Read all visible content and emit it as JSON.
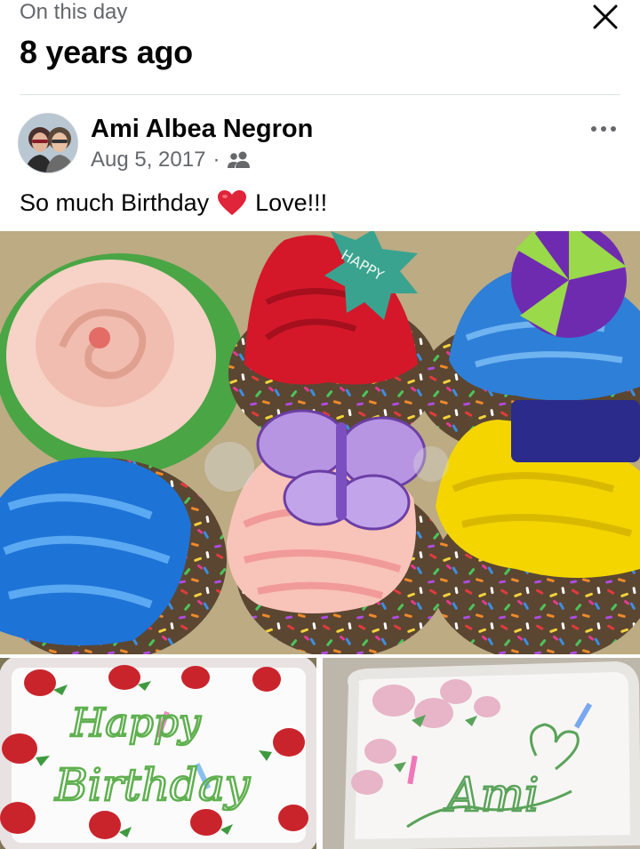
{
  "memory": {
    "eyebrow": "On this day",
    "title": "8 years ago",
    "close_icon": "close-icon"
  },
  "post": {
    "author": "Ami Albea Negron",
    "date": "Aug 5, 2017",
    "separator": "·",
    "audience_icon": "friends-icon",
    "more_icon": "more-horizontal-icon",
    "caption_before": "So much Birthday",
    "caption_emoji": "red-heart-emoji",
    "caption_after": "Love!!!"
  },
  "photos": {
    "main": {
      "topper_text": "HAPPY"
    },
    "left": {
      "cake_text_line1": "Happy",
      "cake_text_line2": "Birthday"
    },
    "right": {
      "cake_text": "Ami"
    }
  },
  "colors": {
    "secondary_text": "#65676b",
    "heart": "#e0243a",
    "icing_green": "#5aa35a",
    "divider": "#dcdfe3"
  }
}
